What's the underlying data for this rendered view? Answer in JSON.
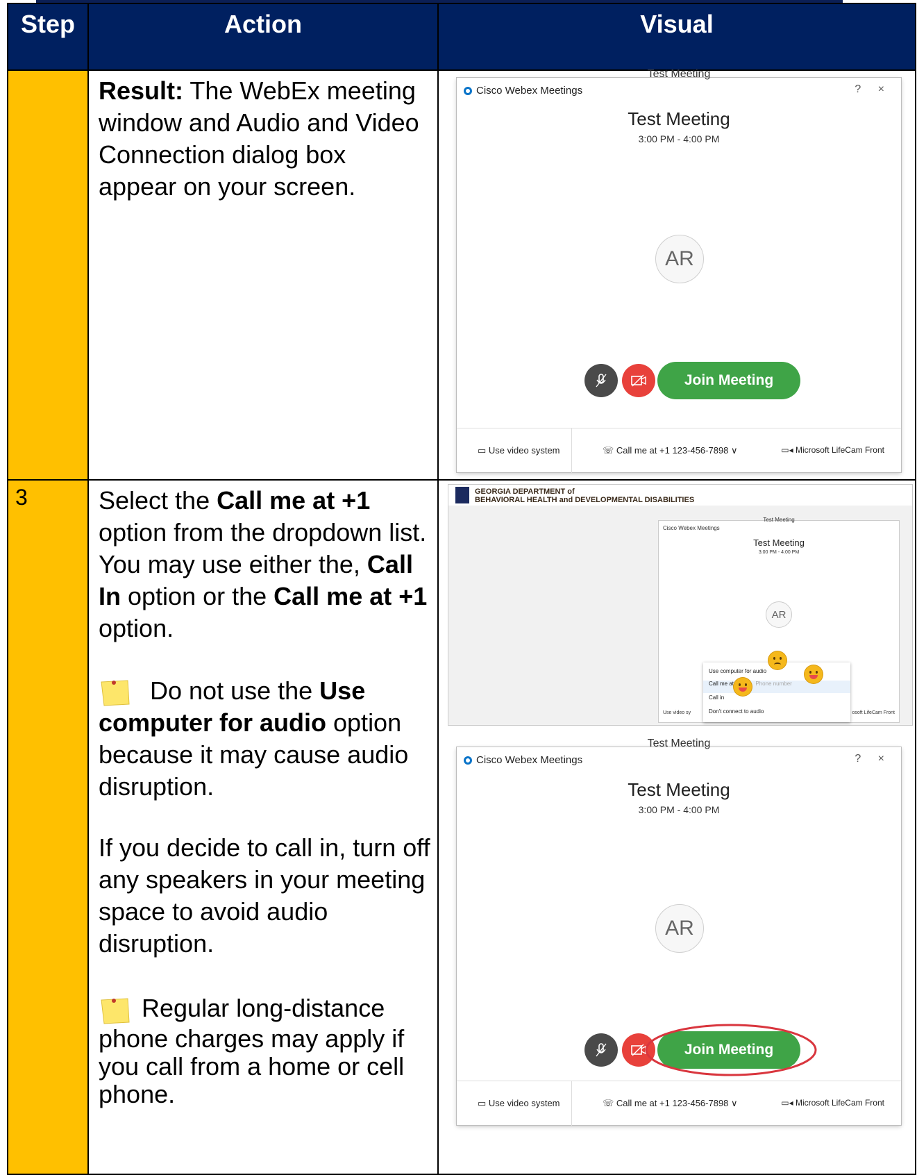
{
  "header": {
    "step": "Step",
    "action": "Action",
    "visual": "Visual"
  },
  "row1": {
    "step": "",
    "action_bold": "Result:",
    "action_text": " The WebEx meeting window and Audio and Video Connection dialog box appear on your screen."
  },
  "row2": {
    "step": "3",
    "p1": [
      "Select the ",
      "Call me at +1",
      " option from the dropdown list. You may use either the, ",
      "Call In",
      " option or the ",
      "Call me at +1",
      " option."
    ],
    "p2": [
      "Do not use the ",
      "Use computer for audio",
      " option because it may cause audio disruption."
    ],
    "p3": "If you decide to call in, turn off any speakers in your meeting space to avoid audio disruption.",
    "p4": "Regular long-distance phone charges may apply if you call from a home or cell phone."
  },
  "webex": {
    "tag": "Test Meeting",
    "app_title": "Cisco Webex Meetings",
    "controls": "? ×",
    "meeting_title": "Test Meeting",
    "time": "3:00 PM - 4:00 PM",
    "avatar": "AR",
    "join": "Join Meeting",
    "video_system": "Use video system",
    "call_me": "Call me at +1 123-456-7898 ∨",
    "camera": "Microsoft LifeCam Front"
  },
  "mini": {
    "org_line1": "GEORGIA DEPARTMENT of",
    "org_line2": "BEHAVIORAL HEALTH and DEVELOPMENTAL DISABILITIES",
    "menu": [
      "Use computer for audio",
      "Call me at   +1",
      "Call in",
      "Don't connect to audio"
    ],
    "phone_placeholder": "Phone number",
    "foot_left": "Use video sy",
    "foot_right": "osoft LifeCam Front"
  },
  "colors": {
    "header_bg": "#002060",
    "step_bg": "#ffc000",
    "join_green": "#3fa447",
    "cam_red": "#e8413b"
  }
}
